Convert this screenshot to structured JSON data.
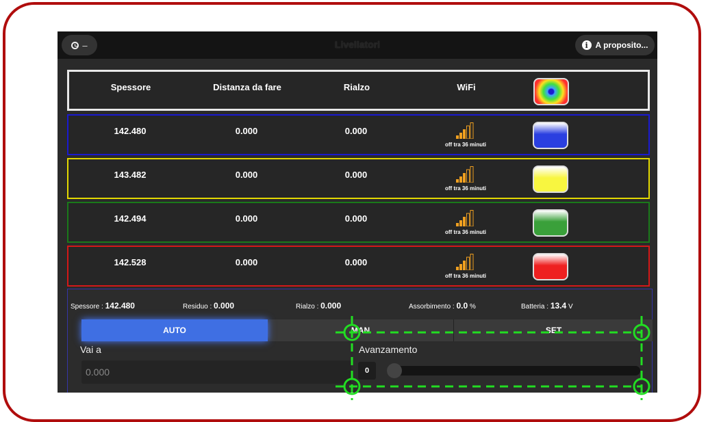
{
  "topbar": {
    "title": "Livellatori",
    "left_label": "–",
    "right_label": "A proposito..."
  },
  "header": {
    "col1": "Spessore",
    "col2": "Distanza da fare",
    "col3": "Rialzo",
    "col4": "WiFi"
  },
  "rows": [
    {
      "spessore": "142.480",
      "distanza": "0.000",
      "rialzo": "0.000",
      "wifi_status": "off tra 36 minuti",
      "color": "#2a3fe0",
      "border": "#1a1acf"
    },
    {
      "spessore": "143.482",
      "distanza": "0.000",
      "rialzo": "0.000",
      "wifi_status": "off tra 36 minuti",
      "color": "#f8f640",
      "border": "#e3d900"
    },
    {
      "spessore": "142.494",
      "distanza": "0.000",
      "rialzo": "0.000",
      "wifi_status": "off tra 36 minuti",
      "color": "#3aa03a",
      "border": "#1a7a1a"
    },
    {
      "spessore": "142.528",
      "distanza": "0.000",
      "rialzo": "0.000",
      "wifi_status": "off tra 36 minuti",
      "color": "#ee2020",
      "border": "#d41818"
    }
  ],
  "status": {
    "spessore_label": "Spessore : ",
    "spessore_value": "142.480",
    "residuo_label": "Residuo : ",
    "residuo_value": "0.000",
    "rialzo_label": "Rialzo : ",
    "rialzo_value": "0.000",
    "assorbimento_label": "Assorbimento : ",
    "assorbimento_value": "0.0",
    "assorbimento_unit": " %",
    "batteria_label": "Batteria : ",
    "batteria_value": "13.4",
    "batteria_unit": " V"
  },
  "tabs": [
    "AUTO",
    "MAN",
    "SET"
  ],
  "active_tab": "AUTO",
  "vai_a": {
    "label": "Vai a",
    "placeholder": "0.000"
  },
  "avanzamento": {
    "label": "Avanzamento",
    "value": "0",
    "slider_fraction": 0
  },
  "colors": {
    "accent": "#3f6fe3",
    "frame": "#b00d0d",
    "wifi": "#f0a020",
    "overlay": "#22dd22"
  }
}
